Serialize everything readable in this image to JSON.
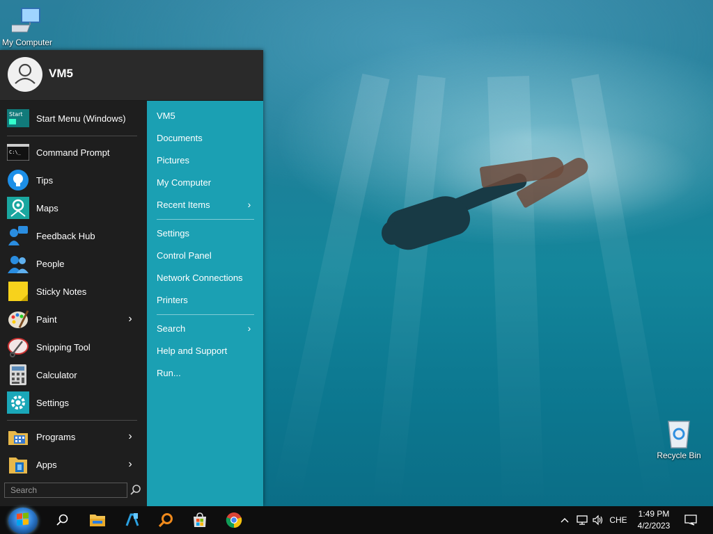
{
  "desktop": {
    "icons": [
      {
        "label": "My Computer",
        "icon": "monitor-icon"
      },
      {
        "label": "Recycle Bin",
        "icon": "recycle-bin-icon"
      }
    ]
  },
  "start_menu": {
    "username": "VM5",
    "left_items": [
      {
        "label": "Start Menu (Windows)",
        "icon": "start-menu-icon",
        "has_submenu": false
      },
      {
        "label": "Command Prompt",
        "icon": "command-prompt-icon",
        "has_submenu": false
      },
      {
        "label": "Tips",
        "icon": "lightbulb-icon",
        "has_submenu": false
      },
      {
        "label": "Maps",
        "icon": "maps-icon",
        "has_submenu": false
      },
      {
        "label": "Feedback Hub",
        "icon": "feedback-hub-icon",
        "has_submenu": false
      },
      {
        "label": "People",
        "icon": "people-icon",
        "has_submenu": false
      },
      {
        "label": "Sticky Notes",
        "icon": "sticky-notes-icon",
        "has_submenu": false
      },
      {
        "label": "Paint",
        "icon": "paint-palette-icon",
        "has_submenu": true
      },
      {
        "label": "Snipping Tool",
        "icon": "snipping-tool-icon",
        "has_submenu": false
      },
      {
        "label": "Calculator",
        "icon": "calculator-icon",
        "has_submenu": false
      },
      {
        "label": "Settings",
        "icon": "gear-icon",
        "has_submenu": false
      },
      {
        "label": "Programs",
        "icon": "programs-folder-icon",
        "has_submenu": true
      },
      {
        "label": "Apps",
        "icon": "apps-icon",
        "has_submenu": true
      }
    ],
    "right_items": [
      {
        "label": "VM5",
        "has_submenu": false
      },
      {
        "label": "Documents",
        "has_submenu": false
      },
      {
        "label": "Pictures",
        "has_submenu": false
      },
      {
        "label": "My Computer",
        "has_submenu": false
      },
      {
        "label": "Recent Items",
        "has_submenu": true
      },
      {
        "label": "Settings",
        "has_submenu": false
      },
      {
        "label": "Control Panel",
        "has_submenu": false
      },
      {
        "label": "Network Connections",
        "has_submenu": false
      },
      {
        "label": "Printers",
        "has_submenu": false
      },
      {
        "label": "Search",
        "has_submenu": true
      },
      {
        "label": "Help and Support",
        "has_submenu": false
      },
      {
        "label": "Run...",
        "has_submenu": false
      }
    ],
    "search": {
      "placeholder": "Search",
      "value": ""
    }
  },
  "taskbar": {
    "pinned": [
      {
        "icon": "search-icon"
      },
      {
        "icon": "file-explorer-icon"
      },
      {
        "icon": "app-store-icon"
      },
      {
        "icon": "magnifier-search-icon"
      },
      {
        "icon": "microsoft-store-icon"
      },
      {
        "icon": "chrome-icon"
      }
    ],
    "tray": {
      "language": "CHE",
      "time": "1:49 PM",
      "date": "4/2/2023"
    }
  },
  "colors": {
    "menu_left_bg": "#1e1e1e",
    "menu_right_bg": "#1ba0b3",
    "menu_header_bg": "#2a2a2a",
    "taskbar_bg": "#0e0e0e"
  }
}
